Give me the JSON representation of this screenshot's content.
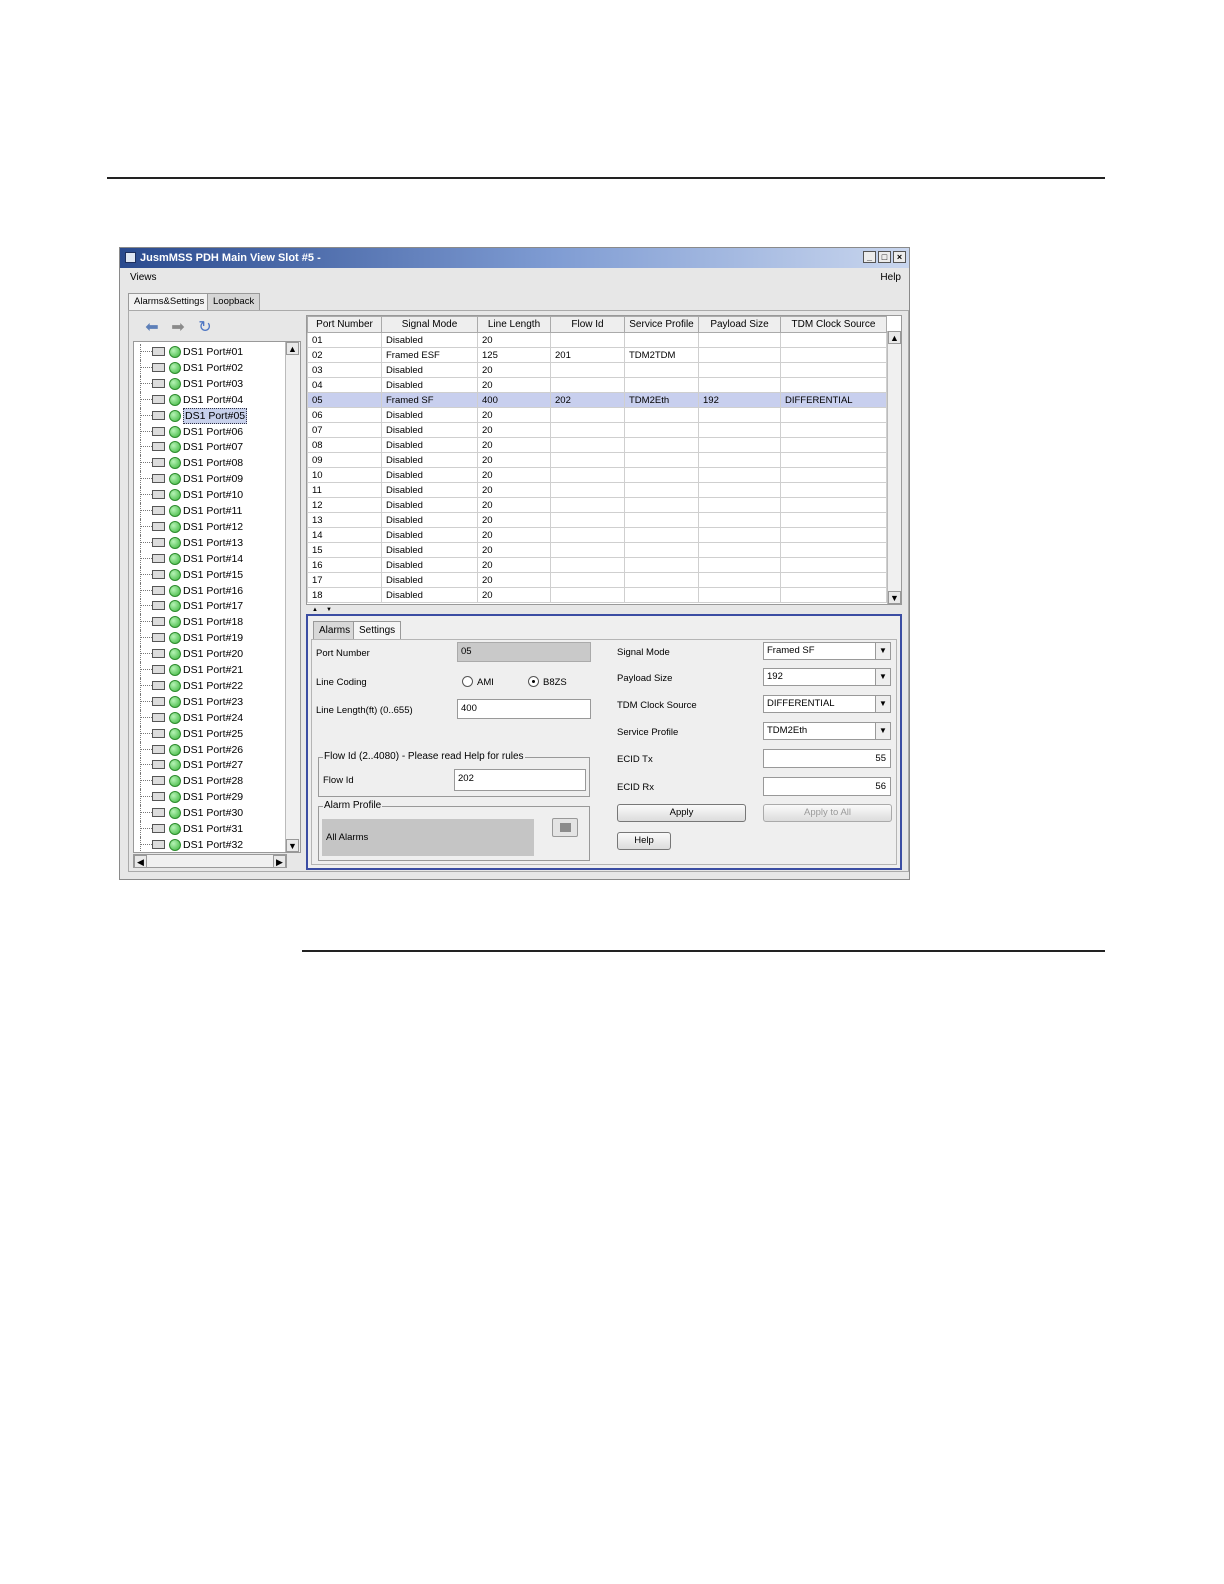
{
  "window": {
    "title": "JusmMSS PDH Main View Slot #5 -"
  },
  "menu": {
    "views": "Views",
    "help": "Help"
  },
  "main_tabs": [
    {
      "label": "Alarms&Settings",
      "active": true
    },
    {
      "label": "Loopback",
      "active": false
    }
  ],
  "toolbar": {
    "back_icon": "back-arrow-icon",
    "forward_icon": "forward-arrow-icon",
    "refresh_icon": "refresh-icon"
  },
  "tree": {
    "selected_index": 4,
    "items": [
      "DS1 Port#01",
      "DS1 Port#02",
      "DS1 Port#03",
      "DS1 Port#04",
      "DS1 Port#05",
      "DS1 Port#06",
      "DS1 Port#07",
      "DS1 Port#08",
      "DS1 Port#09",
      "DS1 Port#10",
      "DS1 Port#11",
      "DS1 Port#12",
      "DS1 Port#13",
      "DS1 Port#14",
      "DS1 Port#15",
      "DS1 Port#16",
      "DS1 Port#17",
      "DS1 Port#18",
      "DS1 Port#19",
      "DS1 Port#20",
      "DS1 Port#21",
      "DS1 Port#22",
      "DS1 Port#23",
      "DS1 Port#24",
      "DS1 Port#25",
      "DS1 Port#26",
      "DS1 Port#27",
      "DS1 Port#28",
      "DS1 Port#29",
      "DS1 Port#30",
      "DS1 Port#31",
      "DS1 Port#32"
    ]
  },
  "table": {
    "columns": [
      "Port Number",
      "Signal Mode",
      "Line Length",
      "Flow Id",
      "Service Profile",
      "Payload Size",
      "TDM Clock Source"
    ],
    "selected_index": 4,
    "rows": [
      [
        "01",
        "Disabled",
        "20",
        "",
        "",
        "",
        ""
      ],
      [
        "02",
        "Framed ESF",
        "125",
        "201",
        "TDM2TDM",
        "",
        ""
      ],
      [
        "03",
        "Disabled",
        "20",
        "",
        "",
        "",
        ""
      ],
      [
        "04",
        "Disabled",
        "20",
        "",
        "",
        "",
        ""
      ],
      [
        "05",
        "Framed SF",
        "400",
        "202",
        "TDM2Eth",
        "192",
        "DIFFERENTIAL"
      ],
      [
        "06",
        "Disabled",
        "20",
        "",
        "",
        "",
        ""
      ],
      [
        "07",
        "Disabled",
        "20",
        "",
        "",
        "",
        ""
      ],
      [
        "08",
        "Disabled",
        "20",
        "",
        "",
        "",
        ""
      ],
      [
        "09",
        "Disabled",
        "20",
        "",
        "",
        "",
        ""
      ],
      [
        "10",
        "Disabled",
        "20",
        "",
        "",
        "",
        ""
      ],
      [
        "11",
        "Disabled",
        "20",
        "",
        "",
        "",
        ""
      ],
      [
        "12",
        "Disabled",
        "20",
        "",
        "",
        "",
        ""
      ],
      [
        "13",
        "Disabled",
        "20",
        "",
        "",
        "",
        ""
      ],
      [
        "14",
        "Disabled",
        "20",
        "",
        "",
        "",
        ""
      ],
      [
        "15",
        "Disabled",
        "20",
        "",
        "",
        "",
        ""
      ],
      [
        "16",
        "Disabled",
        "20",
        "",
        "",
        "",
        ""
      ],
      [
        "17",
        "Disabled",
        "20",
        "",
        "",
        "",
        ""
      ],
      [
        "18",
        "Disabled",
        "20",
        "",
        "",
        "",
        ""
      ]
    ]
  },
  "sub_tabs": [
    {
      "label": "Alarms",
      "active": false
    },
    {
      "label": "Settings",
      "active": true
    }
  ],
  "settings": {
    "port_number_label": "Port Number",
    "port_number_value": "05",
    "line_coding_label": "Line Coding",
    "line_coding_options": [
      "AMI",
      "B8ZS"
    ],
    "line_coding_selected": "B8ZS",
    "line_length_label": "Line Length(ft) (0..655)",
    "line_length_value": "400",
    "flow_group_title": "Flow Id (2..4080) - Please read Help for rules",
    "flow_id_label": "Flow Id",
    "flow_id_value": "202",
    "alarm_group_title": "Alarm Profile",
    "alarm_profile_value": "All Alarms",
    "signal_mode_label": "Signal Mode",
    "signal_mode_value": "Framed SF",
    "payload_size_label": "Payload Size",
    "payload_size_value": "192",
    "tdm_clock_label": "TDM Clock Source",
    "tdm_clock_value": "DIFFERENTIAL",
    "service_profile_label": "Service Profile",
    "service_profile_value": "TDM2Eth",
    "ecid_tx_label": "ECID Tx",
    "ecid_tx_value": "55",
    "ecid_rx_label": "ECID Rx",
    "ecid_rx_value": "56",
    "apply_label": "Apply",
    "apply_all_label": "Apply to All",
    "help_label": "Help"
  }
}
